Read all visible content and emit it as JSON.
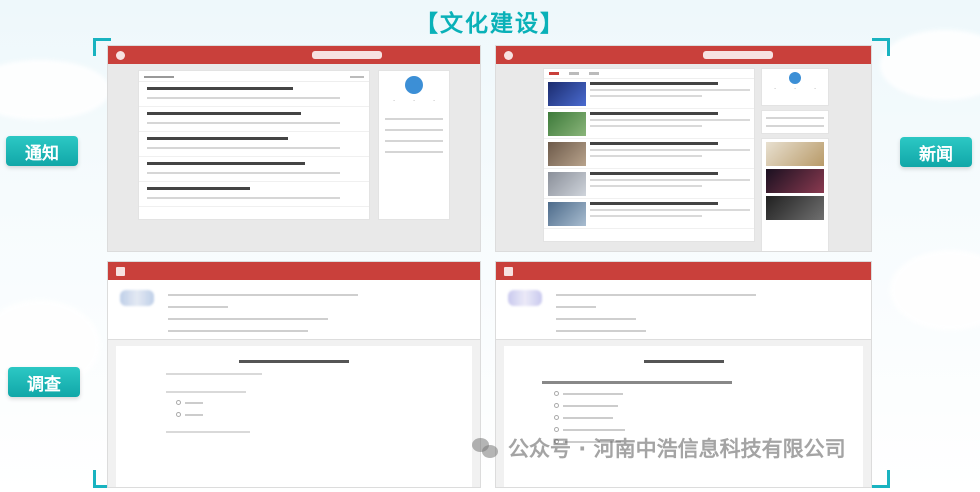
{
  "heading": "【文化建设】",
  "labels": {
    "notice": "通知",
    "news": "新闻",
    "survey": "调查"
  },
  "watermark": {
    "text": "公众号 · 河南中浩信息科技有限公司",
    "icon": "wechat-icon"
  },
  "colors": {
    "accent": "#0ab1b8",
    "header_red": "#c9403b"
  }
}
